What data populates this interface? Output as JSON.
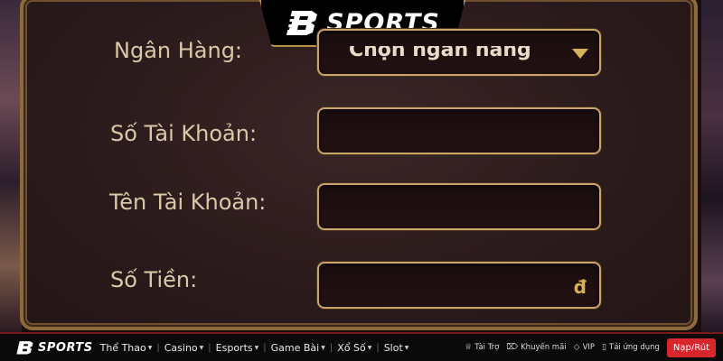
{
  "brand": {
    "name": "SPORTS"
  },
  "form": {
    "bank": {
      "label": "Ngân Hàng:",
      "value": "Chọn ngân hàng"
    },
    "account_number": {
      "label": "Số Tài Khoản:",
      "value": ""
    },
    "account_name": {
      "label": "Tên Tài Khoản:",
      "value": ""
    },
    "amount": {
      "label": "Số Tiền:",
      "value": "",
      "currency": "đ"
    }
  },
  "navbar": {
    "brand": "SPORTS",
    "items": [
      {
        "label": "Thể Thao"
      },
      {
        "label": "Casino"
      },
      {
        "label": "Esports"
      },
      {
        "label": "Game Bài"
      },
      {
        "label": "Xổ Số"
      },
      {
        "label": "Slot"
      }
    ],
    "utilities": [
      {
        "label": "Tài Trợ",
        "icon": "trophy-icon"
      },
      {
        "label": "Khuyến mãi",
        "icon": "tag-icon"
      },
      {
        "label": "VIP",
        "icon": "diamond-icon"
      },
      {
        "label": "Tải ứng dụng",
        "icon": "phone-icon"
      }
    ],
    "deposit_label": "Nạp/Rút"
  },
  "colors": {
    "accent_gold": "#c9a56a",
    "deposit_red": "#d9262d",
    "panel_bg": "#2b1a1b"
  }
}
